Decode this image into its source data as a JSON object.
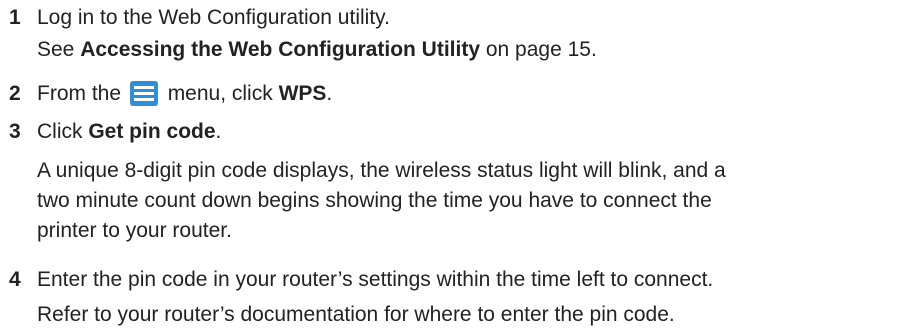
{
  "steps": [
    {
      "num": "1",
      "text": "Log in to the Web Configuration utility.",
      "see_prefix": "See ",
      "see_link": "Accessing the Web Configuration Utility",
      "see_suffix": " on page 15."
    },
    {
      "num": "2",
      "before_icon": "From the ",
      "icon": "hamburger-menu-icon",
      "after_icon": " menu, click ",
      "target": "WPS",
      "end": "."
    },
    {
      "num": "3",
      "prefix": "Click ",
      "target": "Get pin code",
      "end": ".",
      "desc_lines": [
        "A unique 8-digit pin code displays, the wireless status light will blink, and a",
        "two minute count down begins showing the time you have to connect the",
        "printer to your router."
      ]
    },
    {
      "num": "4",
      "text": "Enter the pin code in your router’s settings within the time left to connect.",
      "note": "Refer to your router’s documentation for where to enter the pin code."
    }
  ],
  "colors": {
    "text": "#222222",
    "icon_bg": "#2f8fd6"
  }
}
